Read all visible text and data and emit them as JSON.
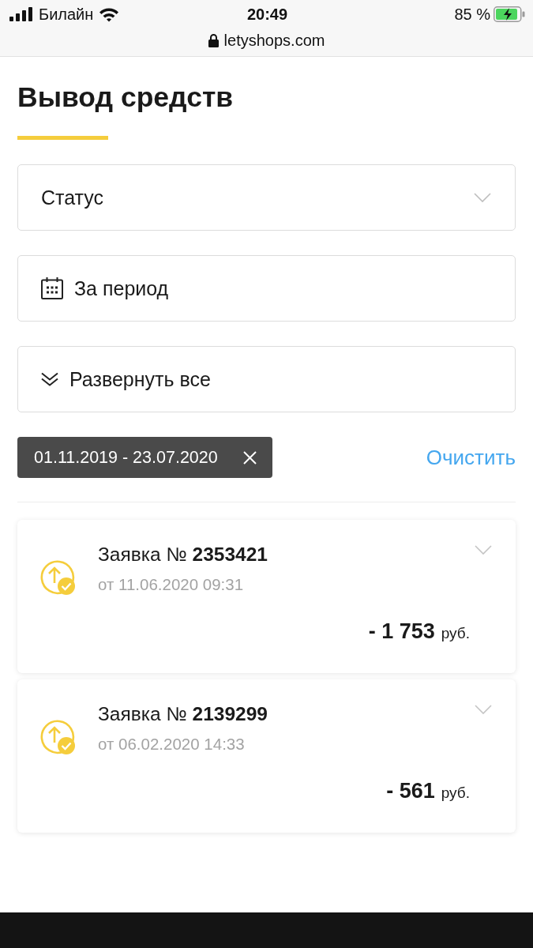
{
  "status_bar": {
    "carrier": "Билайн",
    "time": "20:49",
    "battery": "85 %"
  },
  "address_bar": {
    "url": "letyshops.com"
  },
  "page": {
    "title": "Вывод средств"
  },
  "filters": {
    "status": {
      "label": "Статус"
    },
    "period": {
      "label": "За период"
    },
    "expand_all": {
      "label": "Развернуть все"
    }
  },
  "active_filter": {
    "chip": "01.11.2019 - 23.07.2020",
    "clear": "Очистить"
  },
  "requests": [
    {
      "title": "Заявка № **2353421**",
      "date": "от 11.06.2020 09:31",
      "amount": "- 1 753",
      "currency": "руб.",
      "expanded": false
    },
    {
      "title": "Заявка № **2139299**",
      "date": "от 06.02.2020 14:33",
      "amount": "- 561",
      "currency": "руб.",
      "expanded": false
    }
  ]
}
